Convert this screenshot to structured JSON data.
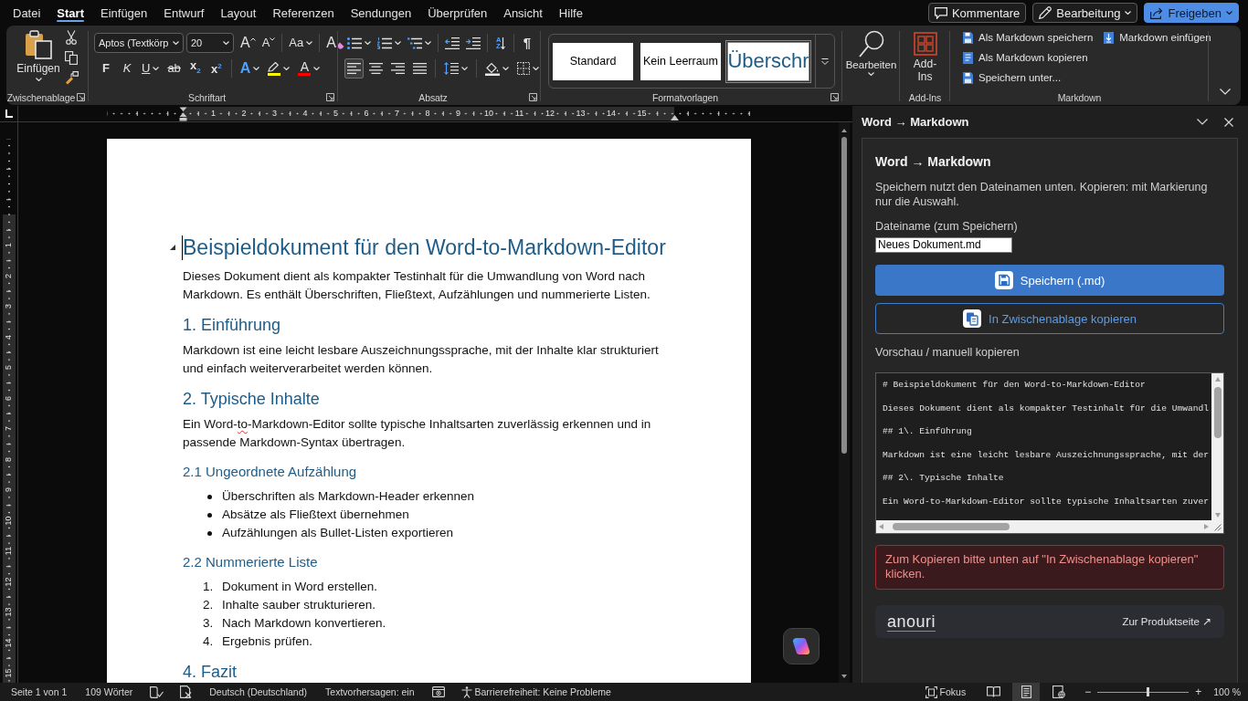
{
  "menu_tabs": [
    {
      "label": "Datei",
      "selected": false
    },
    {
      "label": "Start",
      "selected": true
    },
    {
      "label": "Einfügen",
      "selected": false
    },
    {
      "label": "Entwurf",
      "selected": false
    },
    {
      "label": "Layout",
      "selected": false
    },
    {
      "label": "Referenzen",
      "selected": false
    },
    {
      "label": "Sendungen",
      "selected": false
    },
    {
      "label": "Überprüfen",
      "selected": false
    },
    {
      "label": "Ansicht",
      "selected": false
    },
    {
      "label": "Hilfe",
      "selected": false
    }
  ],
  "title_actions": [
    {
      "kind": "comments",
      "label": "Kommentare"
    },
    {
      "kind": "editing",
      "label": "Bearbeitung",
      "dropdown": true
    },
    {
      "kind": "share",
      "label": "Freigeben",
      "dropdown": true
    }
  ],
  "ribbon": {
    "clipboard": {
      "paste": "Einfügen",
      "tools": [
        {
          "kind": "cut"
        },
        {
          "kind": "copy"
        },
        {
          "kind": "painter"
        }
      ],
      "label": "Zwischenablage"
    },
    "font": {
      "font_name": "Aptos (Textkörp",
      "font_size": "20",
      "row1": [
        {
          "kind": "grow",
          "label": "A"
        },
        {
          "kind": "shrink",
          "label": "A"
        },
        {
          "kind": "sep"
        },
        {
          "kind": "case",
          "label": "Aa",
          "dropdown": true
        },
        {
          "kind": "sep"
        },
        {
          "kind": "clear",
          "label": "A"
        }
      ],
      "row2": [
        {
          "kind": "bold",
          "label": "F"
        },
        {
          "kind": "italic",
          "label": "K"
        },
        {
          "kind": "underline",
          "label": "U",
          "dropdown": true
        },
        {
          "kind": "strike",
          "label": "ab"
        },
        {
          "kind": "subscript",
          "label": "x$_{2}$"
        },
        {
          "kind": "superscript",
          "label": "x$^{2}$"
        },
        {
          "kind": "sep"
        },
        {
          "kind": "effects",
          "label": "A",
          "dropdown": true
        },
        {
          "kind": "highlight",
          "dropdown": true,
          "color": "#ffff00"
        },
        {
          "kind": "fontcolor",
          "label": "A",
          "dropdown": true,
          "color": "#ff0000"
        }
      ],
      "label": "Schriftart"
    },
    "paragraph": {
      "row1": [
        {
          "kind": "bullets",
          "dropdown": true
        },
        {
          "kind": "numbering",
          "dropdown": true
        },
        {
          "kind": "multilevel",
          "dropdown": true
        },
        {
          "kind": "sep"
        },
        {
          "kind": "outdent"
        },
        {
          "kind": "indent"
        },
        {
          "kind": "sep"
        },
        {
          "kind": "sort",
          "label": "AZ"
        },
        {
          "kind": "sep"
        },
        {
          "kind": "pilcrow",
          "label": "¶"
        }
      ],
      "row2": [
        {
          "kind": "align-left",
          "selected": true
        },
        {
          "kind": "align-center",
          "selected": false
        },
        {
          "kind": "align-right",
          "selected": false
        },
        {
          "kind": "justify",
          "selected": false
        },
        {
          "kind": "sep"
        },
        {
          "kind": "line-spacing",
          "dropdown": true
        },
        {
          "kind": "sep"
        },
        {
          "kind": "shading",
          "dropdown": true
        },
        {
          "kind": "borders",
          "dropdown": true
        }
      ],
      "label": "Absatz"
    },
    "styles": {
      "items": [
        {
          "label": "Standard",
          "kind": "body",
          "selected": false
        },
        {
          "label": "Kein Leerraum",
          "kind": "body",
          "selected": false
        },
        {
          "label": "Überschr",
          "kind": "heading",
          "selected": true
        }
      ],
      "label": "Formatvorlagen"
    },
    "editing": {
      "button": "Bearbeiten"
    },
    "addins": {
      "button": "Add-Ins",
      "label": "Add-Ins"
    },
    "markdown": {
      "items": [
        {
          "kind": "save",
          "label": "Als Markdown speichern"
        },
        {
          "kind": "copy",
          "label": "Als Markdown kopieren"
        },
        {
          "kind": "saveas",
          "label": "Speichern unter..."
        },
        {
          "kind": "insert",
          "label": "Markdown einfügen"
        }
      ],
      "label": "Markdown"
    }
  },
  "ruler": {
    "numbers": [
      "1",
      "2",
      "3",
      "4",
      "5",
      "6",
      "7",
      "8",
      "9",
      "10",
      "11",
      "12",
      "13",
      "14",
      "15"
    ]
  },
  "vertical_ruler": {
    "numbers": [
      "1",
      "2",
      "3",
      "4",
      "5",
      "6",
      "7",
      "8",
      "9",
      "10",
      "11",
      "12",
      "13",
      "14",
      "15"
    ]
  },
  "document": {
    "blocks": [
      {
        "kind": "title",
        "text": "Beispieldokument für den Word-to-Markdown-Editor",
        "collapse_handle": true,
        "cursor": true
      },
      {
        "kind": "paragraph",
        "text": "Dieses Dokument dient als kompakter Testinhalt für die Umwandlung von Word nach Markdown. Es enthält Überschriften, Fließtext, Aufzählungen und nummerierte Listen."
      },
      {
        "kind": "heading2",
        "text": "1. Einführung"
      },
      {
        "kind": "paragraph",
        "text": "Markdown ist eine leicht lesbare Auszeichnungssprache, mit der Inhalte klar strukturiert und einfach weiterverarbeitet werden können."
      },
      {
        "kind": "heading2",
        "text": "2. Typische Inhalte"
      },
      {
        "kind": "paragraph",
        "parts": [
          {
            "text": "Ein Word-",
            "misspelled": false
          },
          {
            "text": "to",
            "misspelled": true
          },
          {
            "text": "-Markdown-Editor sollte typische Inhaltsarten zuverlässig erkennen und in passende Markdown-Syntax übertragen.",
            "misspelled": false
          }
        ]
      },
      {
        "kind": "heading3",
        "text": "2.1 Ungeordnete Aufzählung"
      },
      {
        "kind": "bullets",
        "items": [
          "Überschriften als Markdown-Header erkennen",
          "Absätze als Fließtext übernehmen",
          "Aufzählungen als Bullet-Listen exportieren"
        ]
      },
      {
        "kind": "heading3",
        "text": "2.2 Nummerierte Liste"
      },
      {
        "kind": "numbered",
        "items": [
          {
            "number": "1.",
            "text": "Dokument in Word erstellen."
          },
          {
            "number": "2.",
            "text": "Inhalte sauber strukturieren."
          },
          {
            "number": "3.",
            "text": "Nach Markdown konvertieren."
          },
          {
            "number": "4.",
            "text": "Ergebnis prüfen."
          }
        ]
      },
      {
        "kind": "heading2",
        "text": "4. Fazit"
      }
    ]
  },
  "task_pane": {
    "title": "Word → Markdown",
    "heading": "Word → Markdown",
    "description": "Speichern nutzt den Dateinamen unten. Kopieren: mit Markierung nur die Auswahl.",
    "filename_label": "Dateiname (zum Speichern)",
    "filename": "Neues Dokument.md",
    "buttons": [
      {
        "kind": "primary",
        "label": "Speichern (.md)"
      },
      {
        "kind": "secondary",
        "label": "In Zwischenablage kopieren"
      }
    ],
    "preview_label": "Vorschau / manuell kopieren",
    "preview_lines": [
      "# Beispieldokument für den Word-to-Markdown-Editor",
      "Dieses Dokument dient als kompakter Testinhalt für die Umwandl",
      "## 1\\. Einführung",
      "Markdown ist eine leicht lesbare Auszeichnungssprache, mit der",
      "## 2\\. Typische Inhalte",
      "Ein Word-to-Markdown-Editor sollte typische Inhaltsarten zuver"
    ],
    "error": "Zum Kopieren bitte unten auf \"In Zwischenablage kopieren\" klicken.",
    "footer": {
      "logo": "anouri",
      "link": "Zur Produktseite ↗"
    }
  },
  "status_bar": {
    "items": [
      {
        "kind": "text",
        "label": "Seite 1 von 1"
      },
      {
        "kind": "text",
        "label": "109 Wörter"
      },
      {
        "kind": "proofing"
      },
      {
        "kind": "track"
      },
      {
        "kind": "text",
        "label": "Deutsch (Deutschland)"
      },
      {
        "kind": "text",
        "label": "Textvorhersagen: ein"
      },
      {
        "kind": "macro"
      },
      {
        "kind": "accessibility",
        "label": "Barrierefreiheit: Keine Probleme"
      }
    ],
    "focus": "Fokus",
    "views": [
      {
        "kind": "read",
        "selected": false
      },
      {
        "kind": "print",
        "selected": true
      },
      {
        "kind": "web",
        "selected": false
      }
    ],
    "zoom": {
      "minus": "−",
      "plus": "+",
      "level": 0.55,
      "reading": "100 %"
    }
  }
}
